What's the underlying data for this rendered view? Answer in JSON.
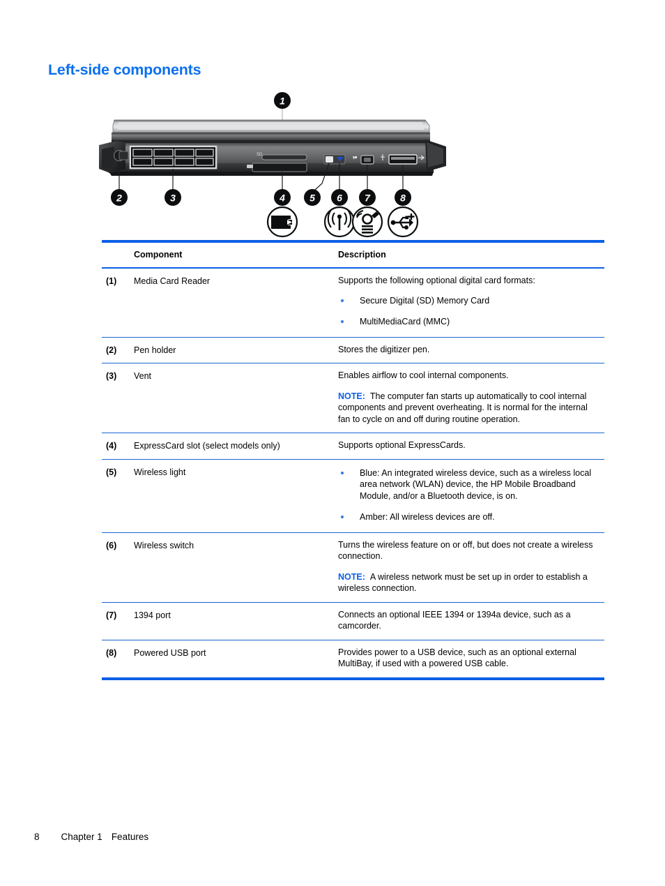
{
  "page": {
    "heading": "Left-side components",
    "footer": {
      "page_number": "8",
      "chapter": "Chapter 1",
      "section": "Features"
    }
  },
  "figure": {
    "alt_name": "left-side-components-diagram",
    "callouts": [
      "1",
      "2",
      "3",
      "4",
      "5",
      "6",
      "7",
      "8"
    ],
    "slot_label": "SD",
    "icons": [
      {
        "callout": "4",
        "name": "expresscard-icon"
      },
      {
        "callout": "6",
        "name": "wireless-antenna-icon"
      },
      {
        "callout": "7",
        "name": "1394-port-icon"
      },
      {
        "callout": "8",
        "name": "powered-usb-icon"
      }
    ]
  },
  "table": {
    "headers": {
      "component": "Component",
      "description": "Description"
    },
    "rows": [
      {
        "num": "(1)",
        "name": "Media Card Reader",
        "desc_lead": "Supports the following optional digital card formats:",
        "bullets": [
          "Secure Digital (SD) Memory Card",
          "MultiMediaCard (MMC)"
        ]
      },
      {
        "num": "(2)",
        "name": "Pen holder",
        "desc_lead": "Stores the digitizer pen."
      },
      {
        "num": "(3)",
        "name": "Vent",
        "desc_lead": "Enables airflow to cool internal components.",
        "note_label": "NOTE:",
        "note_text": "The computer fan starts up automatically to cool internal components and prevent overheating. It is normal for the internal fan to cycle on and off during routine operation."
      },
      {
        "num": "(4)",
        "name": "ExpressCard slot (select models only)",
        "desc_lead": "Supports optional ExpressCards."
      },
      {
        "num": "(5)",
        "name": "Wireless light",
        "bullets": [
          "Blue: An integrated wireless device, such as a wireless local area network (WLAN) device, the HP Mobile Broadband Module, and/or a Bluetooth device, is on.",
          "Amber: All wireless devices are off."
        ]
      },
      {
        "num": "(6)",
        "name": "Wireless switch",
        "desc_lead": "Turns the wireless feature on or off, but does not create a wireless connection.",
        "note_label": "NOTE:",
        "note_text": "A wireless network must be set up in order to establish a wireless connection."
      },
      {
        "num": "(7)",
        "name": "1394 port",
        "desc_lead": "Connects an optional IEEE 1394 or 1394a device, such as a camcorder."
      },
      {
        "num": "(8)",
        "name": "Powered USB port",
        "desc_lead": "Provides power to a USB device, such as an optional external MultiBay, if used with a powered USB cable."
      }
    ]
  },
  "colors": {
    "heading_blue": "#0b6ff0",
    "rule_blue": "#0b5fe6",
    "note_blue": "#0b5fe6",
    "bullet_blue": "#2f7de0"
  }
}
